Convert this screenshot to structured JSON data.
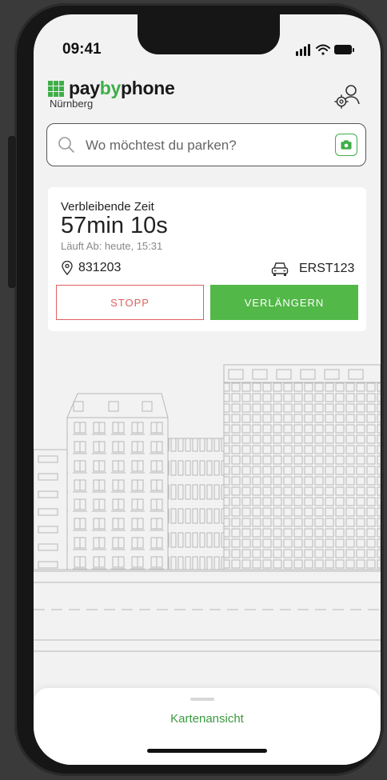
{
  "status_bar": {
    "time": "09:41"
  },
  "brand": {
    "name_part1": "pay",
    "name_part2": "by",
    "name_part3": "phone",
    "city": "Nürnberg"
  },
  "search": {
    "placeholder": "Wo möchtest du parken?"
  },
  "session": {
    "title": "Verbleibende Zeit",
    "remaining": "57min 10s",
    "expiry": "Läuft Ab: heute, 15:31",
    "zone": "831203",
    "plate": "ERST123",
    "stop_label": "STOPP",
    "extend_label": "VERLÄNGERN"
  },
  "sheet": {
    "label": "Kartenansicht"
  },
  "colors": {
    "brand_green": "#3fae49",
    "stop_red": "#e06060",
    "background": "#f2f2f2"
  },
  "icons": [
    "settings-user-icon",
    "search-icon",
    "camera-icon",
    "location-pin-icon",
    "car-icon"
  ]
}
